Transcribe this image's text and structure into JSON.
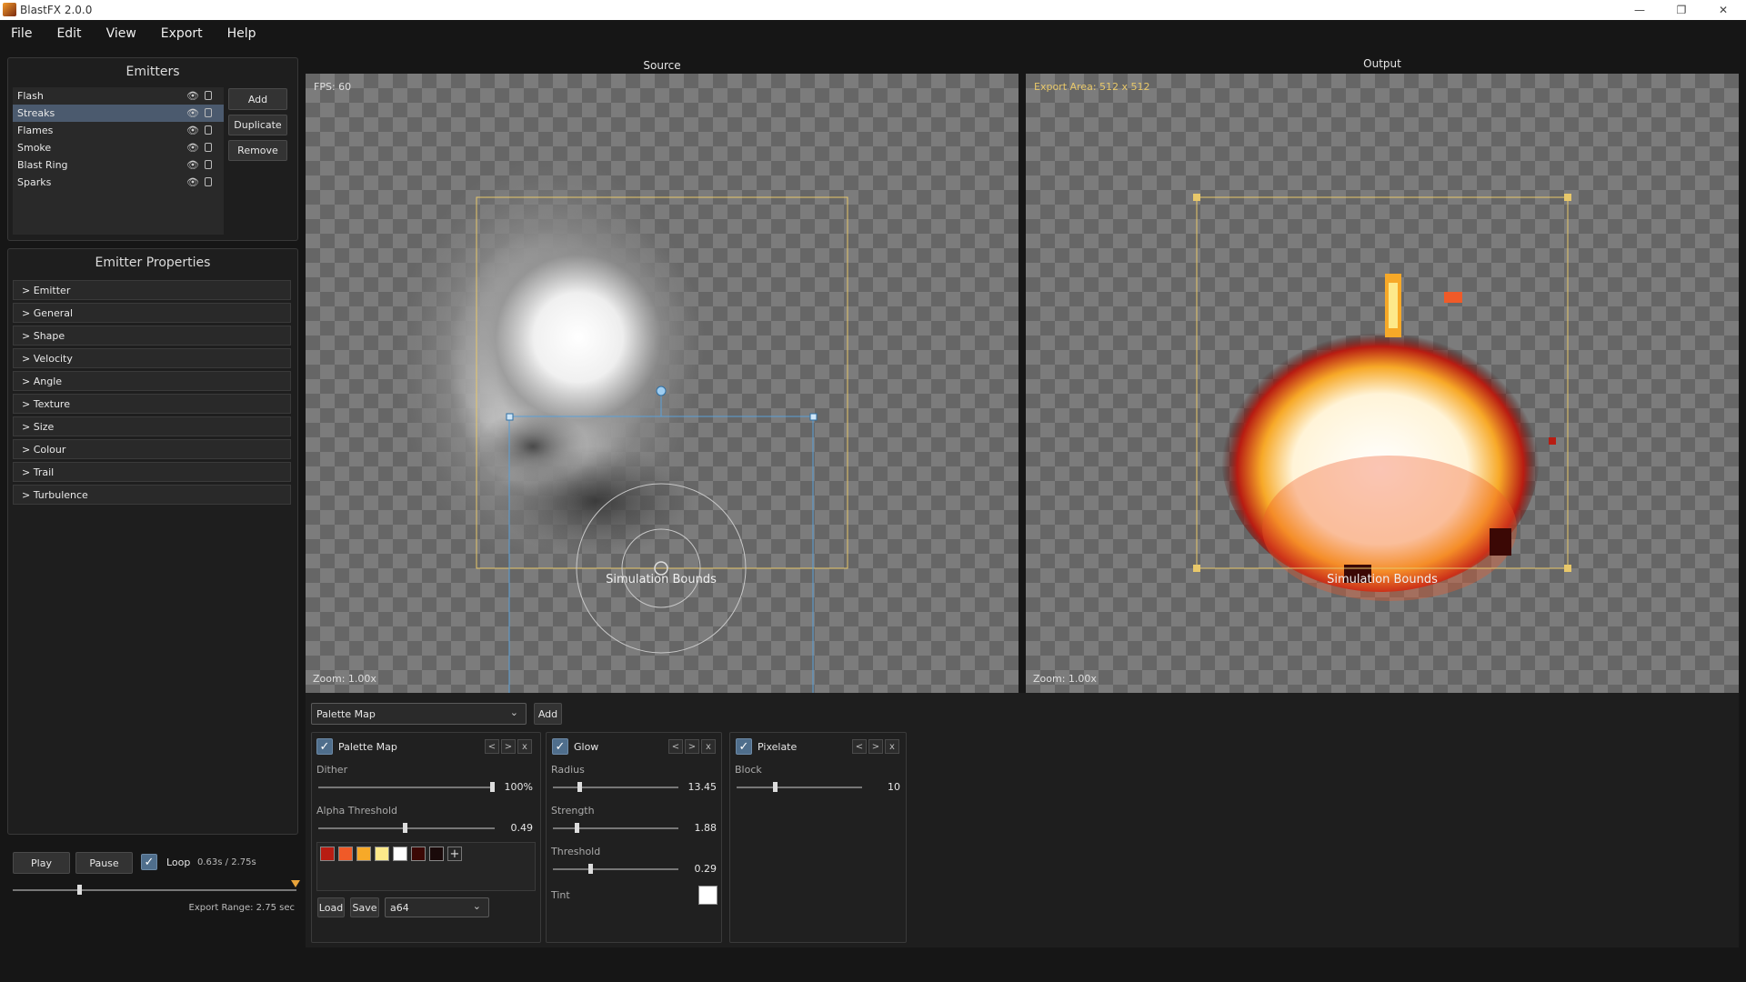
{
  "window": {
    "title": "BlastFX 2.0.0",
    "controls": [
      "—",
      "❐",
      "✕"
    ]
  },
  "menu": [
    "File",
    "Edit",
    "View",
    "Export",
    "Help"
  ],
  "emitters_panel": {
    "title": "Emitters",
    "items": [
      {
        "label": "Flash"
      },
      {
        "label": "Streaks"
      },
      {
        "label": "Flames"
      },
      {
        "label": "Smoke"
      },
      {
        "label": "Blast Ring"
      },
      {
        "label": "Sparks"
      }
    ],
    "selected": "Streaks",
    "buttons": {
      "add": "Add",
      "duplicate": "Duplicate",
      "remove": "Remove"
    },
    "eye_glyph": "👁"
  },
  "properties_panel": {
    "title": "Emitter Properties",
    "sections": [
      "> Emitter",
      "> General",
      "> Shape",
      "> Velocity",
      "> Angle",
      "> Texture",
      "> Size",
      "> Colour",
      "> Trail",
      "> Turbulence"
    ]
  },
  "playback": {
    "play": "Play",
    "pause": "Pause",
    "loop_label": "Loop",
    "loop_checked": true,
    "time": "0.63s / 2.75s",
    "export_range": "Export Range: 2.75 sec",
    "progress": 0.23
  },
  "source_view": {
    "title": "Source",
    "fps": "FPS: 60",
    "zoom": "Zoom: 1.00x",
    "bounds_label": "Simulation Bounds"
  },
  "output_view": {
    "title": "Output",
    "export_area": "Export Area: 512 x 512",
    "zoom": "Zoom: 1.00x",
    "bounds_label": "Simulation Bounds"
  },
  "effects_bar": {
    "select_value": "Palette Map",
    "add": "Add"
  },
  "palette_map": {
    "title": "Palette Map",
    "enabled": true,
    "dither_label": "Dither",
    "dither_value": "100%",
    "dither_level": 1.0,
    "alpha_label": "Alpha Threshold",
    "alpha_value": "0.49",
    "alpha_level": 0.49,
    "swatches": [
      "#b81c12",
      "#f05a28",
      "#f7a928",
      "#fde98a",
      "#ffffff",
      "#3b0805",
      "#1a0a0a"
    ],
    "add_swatch": "+",
    "load": "Load",
    "save": "Save",
    "preset": "a64"
  },
  "glow": {
    "title": "Glow",
    "enabled": true,
    "radius_label": "Radius",
    "radius_value": "13.45",
    "radius_level": 0.2,
    "strength_label": "Strength",
    "strength_value": "1.88",
    "strength_level": 0.18,
    "threshold_label": "Threshold",
    "threshold_value": "0.29",
    "threshold_level": 0.29,
    "tint_label": "Tint",
    "tint_color": "#ffffff"
  },
  "pixelate": {
    "title": "Pixelate",
    "enabled": true,
    "block_label": "Block",
    "block_value": "10",
    "block_level": 0.3
  },
  "nav": {
    "prev": "<",
    "next": ">",
    "close": "x"
  },
  "check_glyph": "✓",
  "colors": {
    "selection": "#4b5a6e",
    "bounds": "#e8c86a",
    "handles": "#5aa0d8",
    "checkbox": "#4f6e8c"
  }
}
